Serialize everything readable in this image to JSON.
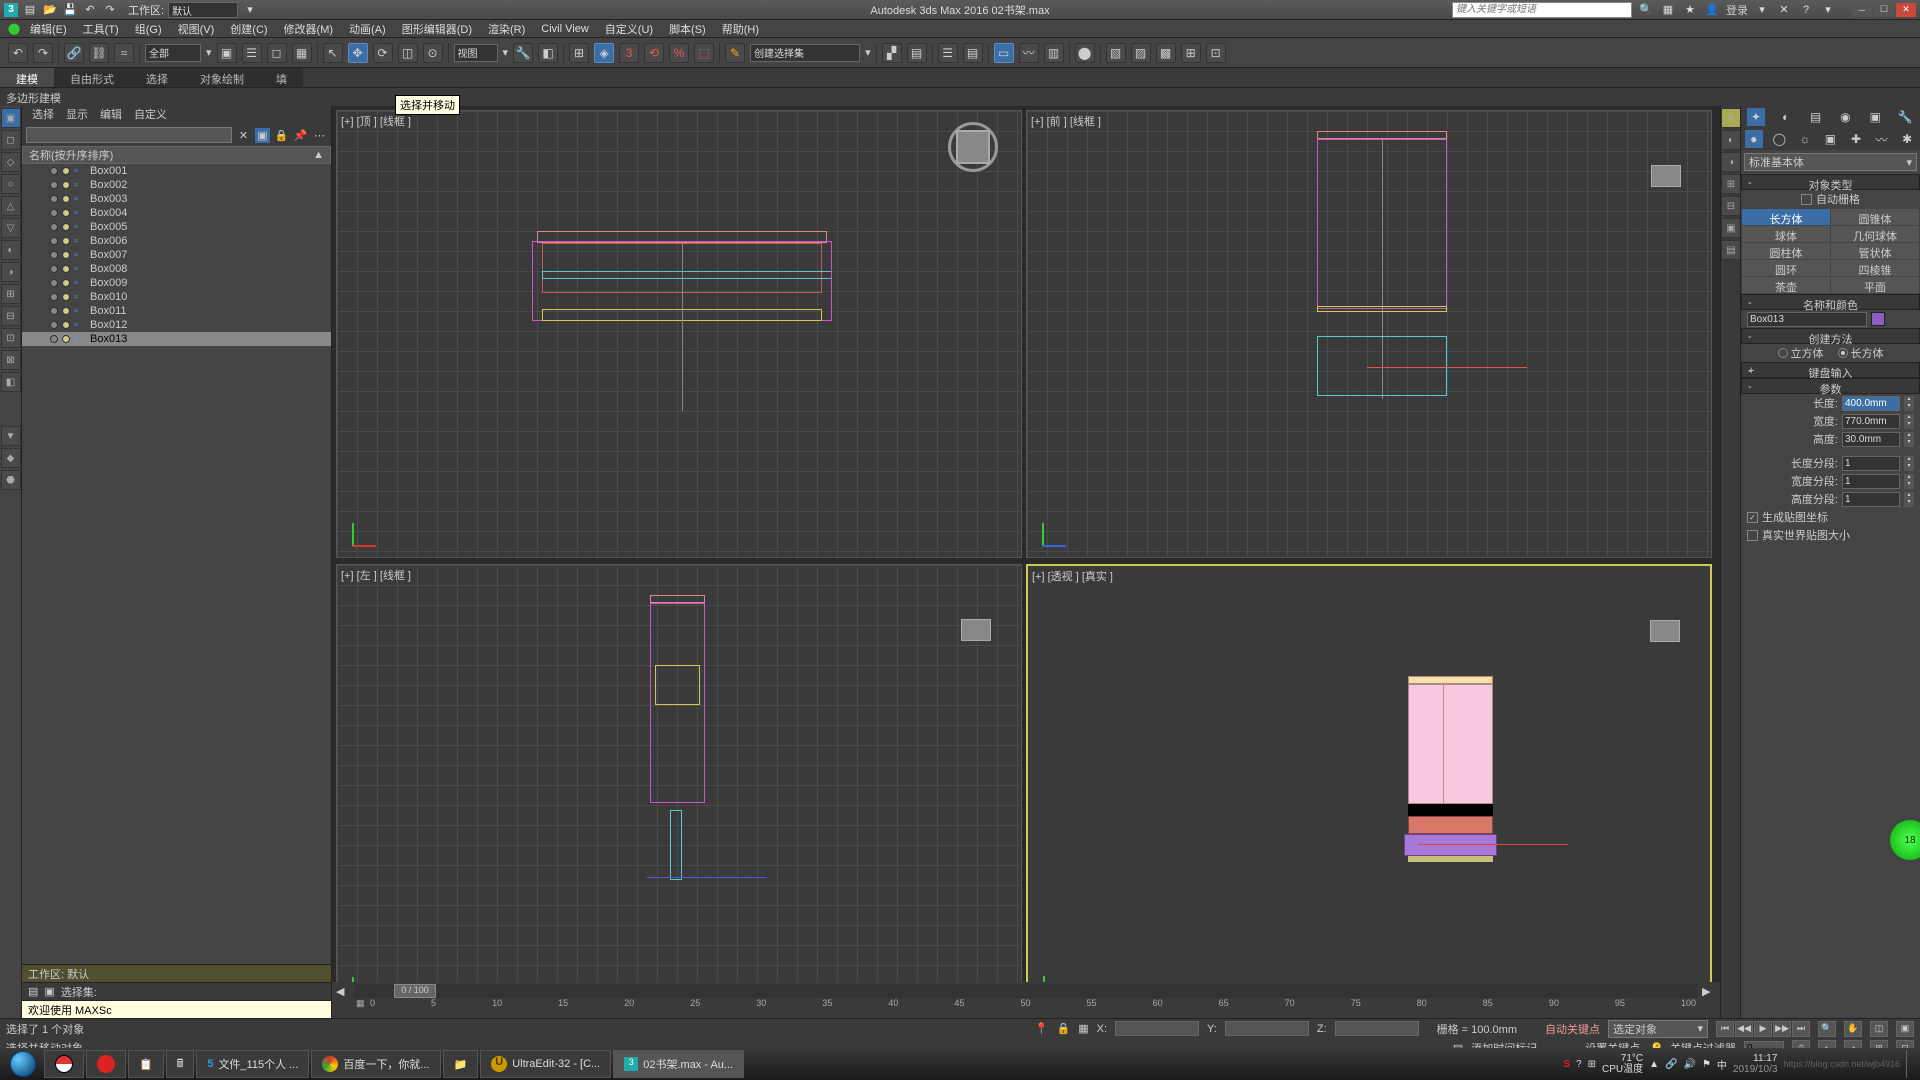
{
  "title_center": "Autodesk 3ds Max 2016     02书架.max",
  "workspace_label": "工作区: ",
  "workspace_value": "默认",
  "search_placeholder": "键入关键字或短语",
  "login": "登录",
  "menus": [
    "编辑(E)",
    "工具(T)",
    "组(G)",
    "视图(V)",
    "创建(C)",
    "修改器(M)",
    "动画(A)",
    "图形编辑器(D)",
    "渲染(R)",
    "Civil View",
    "自定义(U)",
    "脚本(S)",
    "帮助(H)"
  ],
  "toolbar_combo_all": "全部",
  "toolbar_combo_view": "视图",
  "toolbar_combo_named": "创建选择集",
  "tooltip": "选择并移动",
  "left_tabs": [
    "建模",
    "自由形式",
    "选择",
    "对象绘制",
    "填"
  ],
  "subbar": "多边形建模",
  "lp_tabs": [
    "选择",
    "显示",
    "编辑",
    "自定义"
  ],
  "list_header": "名称(按升序排序)",
  "boxes": [
    "Box001",
    "Box002",
    "Box003",
    "Box004",
    "Box005",
    "Box006",
    "Box007",
    "Box008",
    "Box009",
    "Box010",
    "Box011",
    "Box012",
    "Box013"
  ],
  "selected_box": "Box013",
  "lp_foot1": "工作区: 默认",
  "lp_foot2": "选择集:",
  "welcome": "欢迎使用 MAXSc",
  "status_selected": "选择了 1 个对象",
  "status_prompt": "选择并移动对象",
  "vp_tl": "[+] [顶 ] [线框 ]",
  "vp_tr": "[+] [前 ] [线框 ]",
  "vp_bl": "[+] [左 ] [线框 ]",
  "vp_br": "[+] [透视 ] [真实 ]",
  "time_thumb": "0 / 100",
  "grid_label": "栅格 = 100.0mm",
  "add_time": "添加时间标记",
  "auto_key": "自动关键点",
  "set_key": "设置关键点",
  "key_combo": "选定对象",
  "key_filter": "关键点过滤器",
  "rp_combo": "标准基本体",
  "rp_sec_type": "对象类型",
  "rp_autogrid": "自动栅格",
  "rp_types": [
    "长方体",
    "圆锥体",
    "球体",
    "几何球体",
    "圆柱体",
    "管状体",
    "圆环",
    "四棱锥",
    "茶壶",
    "平面"
  ],
  "rp_sec_name": "名称和颜色",
  "rp_name_val": "Box013",
  "rp_sec_method": "创建方法",
  "rp_method1": "立方体",
  "rp_method2": "长方体",
  "rp_sec_kb": "键盘输入",
  "rp_sec_param": "参数",
  "rp_len": "长度:",
  "rp_len_v": "400.0mm",
  "rp_wid": "宽度:",
  "rp_wid_v": "770.0mm",
  "rp_hei": "高度:",
  "rp_hei_v": "30.0mm",
  "rp_lseg": "长度分段:",
  "rp_lseg_v": "1",
  "rp_wseg": "宽度分段:",
  "rp_wseg_v": "1",
  "rp_hseg": "高度分段:",
  "rp_hseg_v": "1",
  "rp_gen": "生成贴图坐标",
  "rp_real": "真实世界贴图大小",
  "tasks": [
    "文件_115个人 ...",
    "百度一下，你就...",
    "",
    "UltraEdit-32 - [C...",
    "02书架.max - Au..."
  ],
  "tray_temp": "71°C",
  "tray_cpu": "CPU温度",
  "tray_time": "11:17",
  "tray_date": "2019/10/3",
  "tray_watermark": "https://blog.csdn.net/wjb4916",
  "orb_text": "18"
}
